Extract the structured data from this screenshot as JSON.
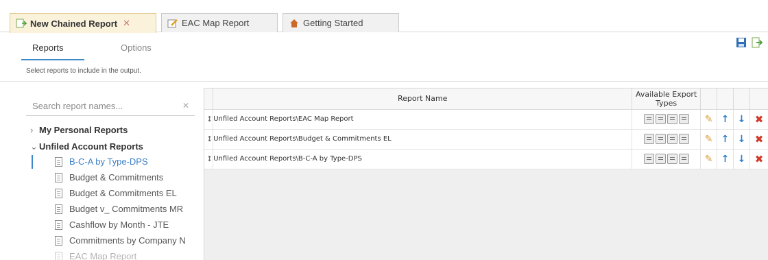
{
  "tabs": [
    {
      "label": "New Chained Report",
      "close": "✕",
      "active": true
    },
    {
      "label": "EAC Map Report",
      "active": false
    },
    {
      "label": "Getting Started",
      "active": false
    }
  ],
  "subtabs": {
    "reports": "Reports",
    "options": "Options"
  },
  "hint": "Select reports to include in the output.",
  "search": {
    "placeholder": "Search report names...",
    "clear": "✕"
  },
  "tree": {
    "personal": "My Personal Reports",
    "unfiled": "Unfiled Account Reports",
    "items": [
      "B-C-A by Type-DPS",
      "Budget & Commitments",
      "Budget & Commitments EL",
      "Budget v_ Commitments MR",
      "Cashflow by Month - JTE",
      "Commitments by Company N",
      "EAC Map Report"
    ]
  },
  "grid": {
    "col_name": "Report Name",
    "col_export_line1": "Available Export",
    "col_export_line2": "Types",
    "drag_glyph": "↕",
    "rows": [
      {
        "name": "Unfiled Account Reports\\EAC Map Report"
      },
      {
        "name": "Unfiled Account Reports\\Budget & Commitments EL"
      },
      {
        "name": "Unfiled Account Reports\\B-C-A by Type-DPS"
      }
    ]
  },
  "colors": {
    "accent": "#3c89c9",
    "active_tab": "#fbf2dc",
    "delete": "#d23a2a",
    "arrow": "#2c7fd1",
    "edit": "#d9a03a"
  }
}
